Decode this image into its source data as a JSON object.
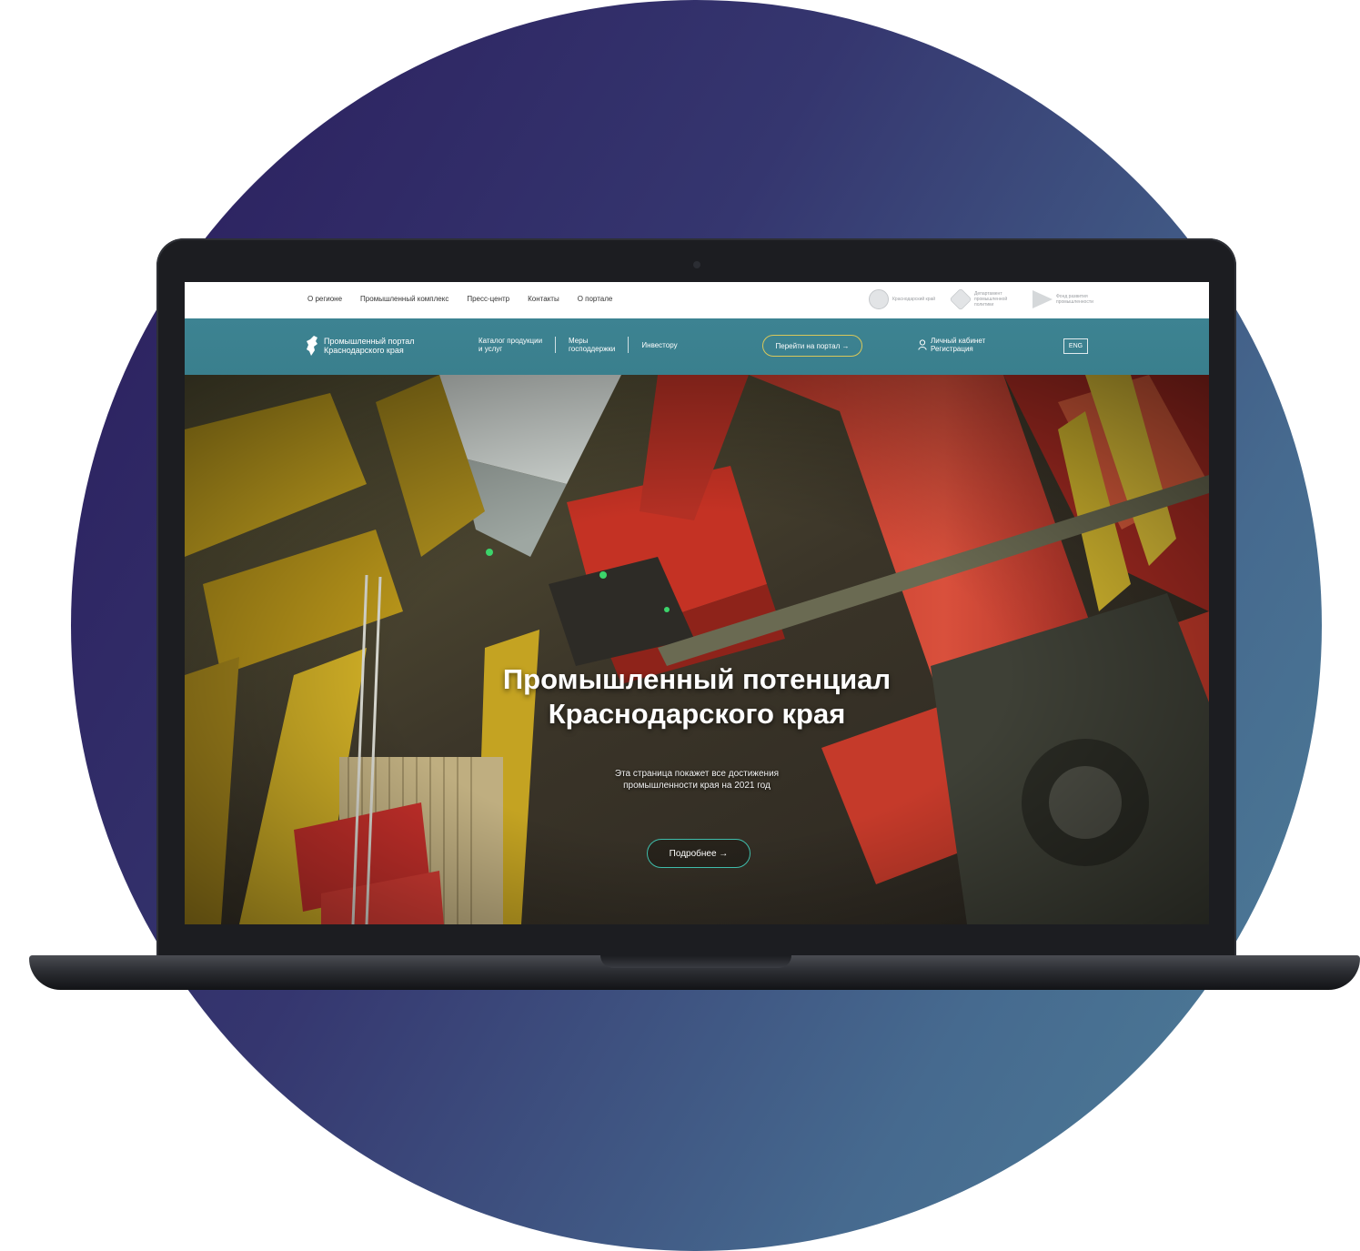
{
  "top_nav": {
    "items": [
      "О регионе",
      "Промышленный комплекс",
      "Пресс-центр",
      "Контакты",
      "О портале"
    ]
  },
  "partners": [
    {
      "icon": "emblem-icon",
      "text": "Краснодарский край"
    },
    {
      "icon": "hexagon-icon",
      "text": "Департамент промышленной политики"
    },
    {
      "icon": "arrow-icon",
      "text": "Фонд развития промышленности"
    }
  ],
  "header": {
    "logo_line1": "Промышленный портал",
    "logo_line2": "Краснодарского края",
    "menu": [
      {
        "line1": "Каталог продукции",
        "line2": "и услуг"
      },
      {
        "line1": "Меры",
        "line2": "господдержки"
      },
      {
        "line1": "Инвестору",
        "line2": ""
      }
    ],
    "portal_button": "Перейти на портал →",
    "account_label": "Личный кабинет",
    "register_label": "Регистрация",
    "lang_button": "ENG"
  },
  "hero": {
    "title_line1": "Промышленный потенциал",
    "title_line2": "Краснодарского края",
    "subtitle_line1": "Эта страница покажет все достижения",
    "subtitle_line2": "промышленности края на 2021 год",
    "button": "Подробнее →"
  },
  "colors": {
    "navbar": "#3b8090",
    "portal_button_border": "#d9c85a",
    "more_button_border": "#3fbcaa",
    "backdrop_start": "#2a1c5c",
    "backdrop_end": "#4e8099"
  }
}
